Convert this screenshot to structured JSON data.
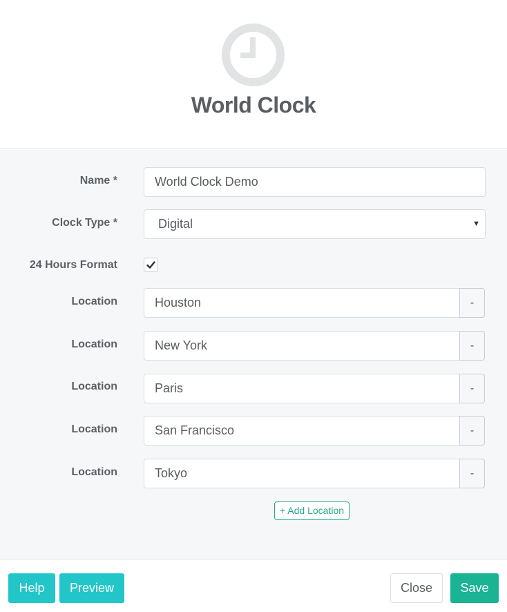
{
  "header": {
    "title": "World Clock",
    "icon": "clock-icon"
  },
  "form": {
    "name": {
      "label": "Name *",
      "value": "World Clock Demo"
    },
    "clock_type": {
      "label": "Clock Type *",
      "selected": "Digital"
    },
    "hours_format": {
      "label": "24 Hours Format",
      "checked": true
    },
    "locations": [
      {
        "label": "Location",
        "value": "Houston",
        "remove_label": "-"
      },
      {
        "label": "Location",
        "value": "New York",
        "remove_label": "-"
      },
      {
        "label": "Location",
        "value": "Paris",
        "remove_label": "-"
      },
      {
        "label": "Location",
        "value": "San Francisco",
        "remove_label": "-"
      },
      {
        "label": "Location",
        "value": "Tokyo",
        "remove_label": "-"
      }
    ],
    "add_location_label": "+ Add Location"
  },
  "footer": {
    "help_label": "Help",
    "preview_label": "Preview",
    "close_label": "Close",
    "save_label": "Save"
  },
  "colors": {
    "info": "#23c6c8",
    "primary": "#1ab394",
    "accent_outline": "#26a98a",
    "icon_grey": "#e2e3e4"
  }
}
